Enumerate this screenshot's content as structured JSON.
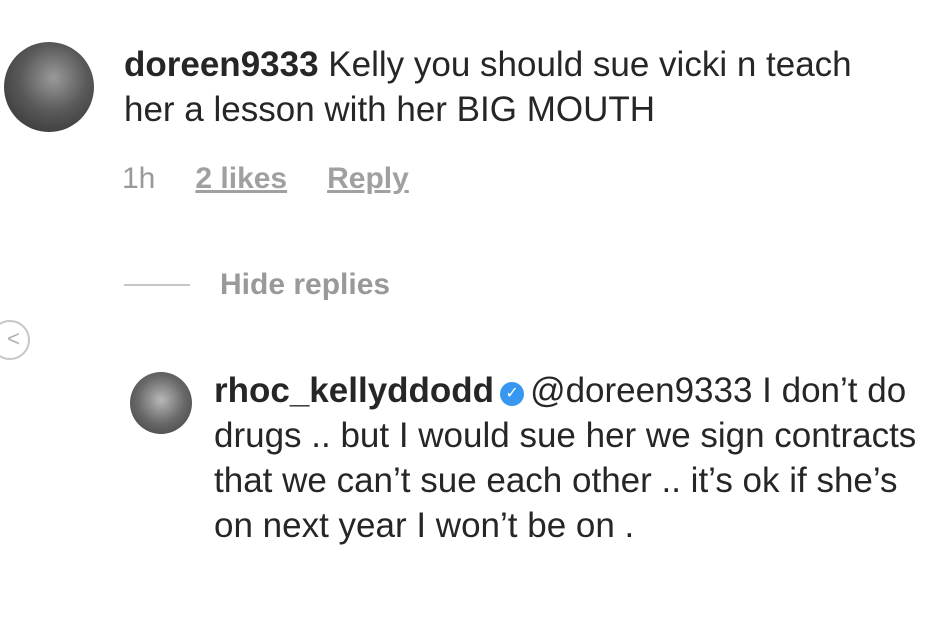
{
  "comment": {
    "username": "doreen9333",
    "text": "Kelly you should sue vicki n teach her a lesson with her BIG MOUTH",
    "time": "1h",
    "likes": "2 likes",
    "reply": "Reply"
  },
  "hide_replies": "Hide replies",
  "back_icon_glyph": "<",
  "reply_comment": {
    "username": "rhoc_kellyddodd",
    "verified_icon": "verified-badge-icon",
    "text": "@doreen9333 I don’t do drugs .. but I would sue her we sign contracts that we can’t sue each other .. it’s ok if she’s on next year I won’t be on ."
  },
  "colors": {
    "text": "#262626",
    "muted": "#999999",
    "verified": "#3897f0"
  }
}
